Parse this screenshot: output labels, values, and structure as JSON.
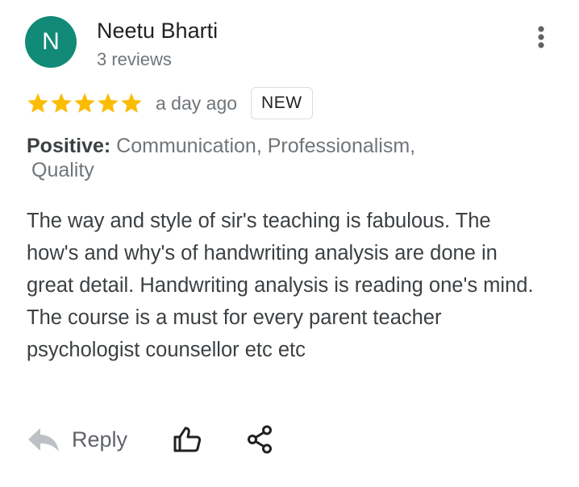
{
  "review": {
    "avatar_letter": "N",
    "reviewer_name": "Neetu Bharti",
    "review_count": "3 reviews",
    "rating": 5,
    "rating_max": 5,
    "time": "a day ago",
    "badge": "NEW",
    "highlights_label": "Positive:",
    "highlights_line1": "Communication, Professionalism,",
    "highlights_line2": "Quality",
    "text": "The way and style of sir's teaching is fabulous. The how's and why's of handwriting analysis are done in great detail. Handwriting analysis is reading one's mind. The course is a must for every parent teacher psychologist counsellor etc etc"
  },
  "actions": {
    "reply_label": "Reply",
    "reply_icon": "reply-arrow-icon",
    "like_icon": "thumbs-up-icon",
    "share_icon": "share-icon"
  },
  "colors": {
    "avatar": "#128a78",
    "star": "#fbbc04",
    "secondary_text": "#70757a"
  }
}
